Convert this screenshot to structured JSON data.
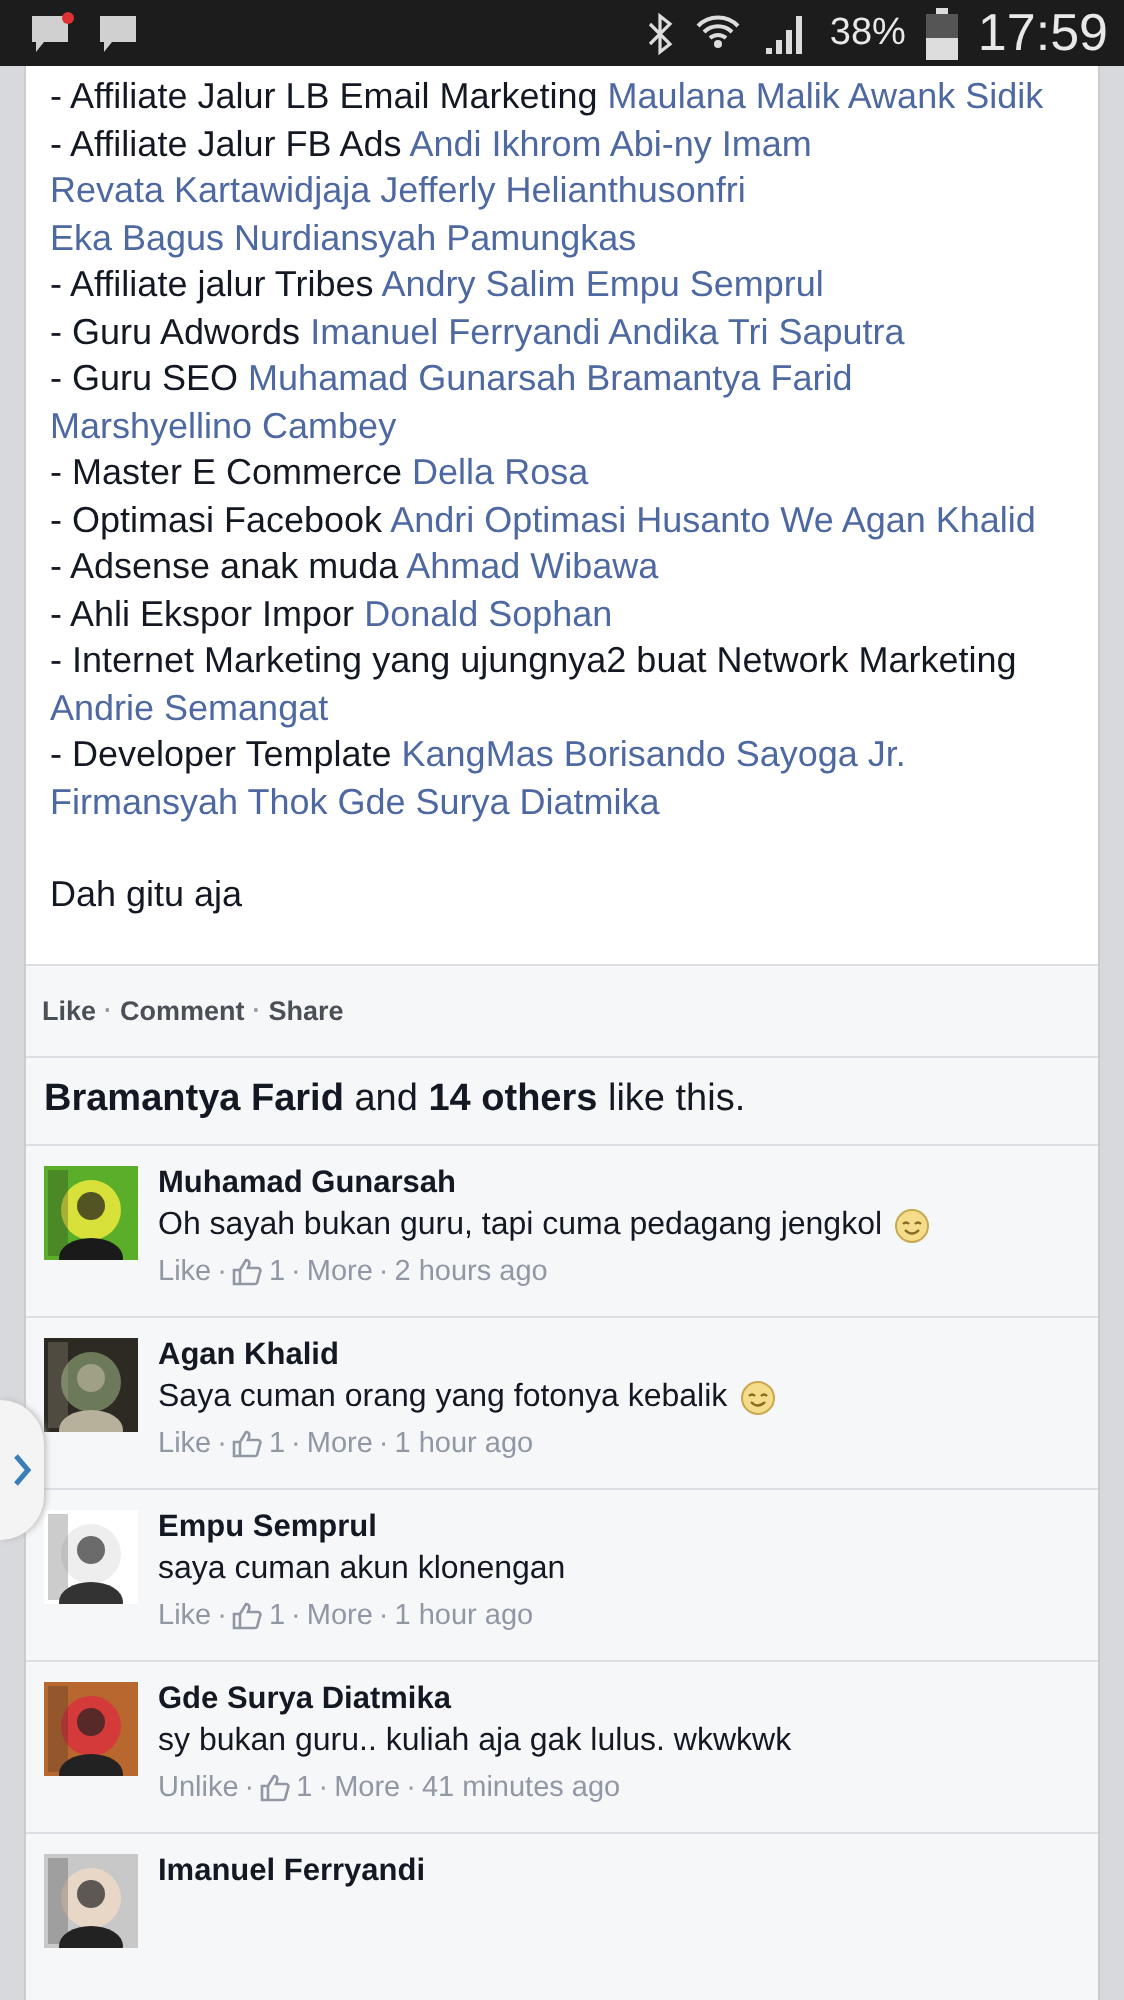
{
  "status_bar": {
    "battery": "38%",
    "time": "17:59"
  },
  "post": {
    "lines": [
      {
        "text": "- Affiliate Jalur LB Email Marketing",
        "tags": [
          "Maulana Malik",
          "Awank Sidik"
        ]
      },
      {
        "text": "- Affiliate Jalur FB Ads",
        "tags": [
          "Andi Ikhrom",
          "Abi-ny Imam",
          "Revata Kartawidjaja",
          "Jefferly Helianthusonfri",
          "Eka Bagus Nurdiansyah Pamungkas"
        ]
      },
      {
        "text": "- Affiliate jalur Tribes",
        "tags": [
          "Andry Salim",
          "Empu Semprul"
        ]
      },
      {
        "text": "- Guru Adwords",
        "tags": [
          "Imanuel Ferryandi",
          "Andika Tri Saputra"
        ]
      },
      {
        "text": "- Guru SEO",
        "tags": [
          "Muhamad Gunarsah",
          "Bramantya Farid",
          "Marshyellino Cambey"
        ]
      },
      {
        "text": "- Master E Commerce",
        "tags": [
          "Della Rosa"
        ]
      },
      {
        "text": "- Optimasi Facebook",
        "tags": [
          "Andri Optimasi Husanto We",
          "Agan Khalid"
        ]
      },
      {
        "text": "- Adsense anak muda",
        "tags": [
          "Ahmad Wibawa"
        ]
      },
      {
        "text": "- Ahli Ekspor Impor",
        "tags": [
          "Donald Sophan"
        ]
      },
      {
        "text": "- Internet Marketing yang ujungnya2 buat Network Marketing",
        "tags": [
          "Andrie Semangat"
        ]
      },
      {
        "text": "- Developer Template",
        "tags": [
          "KangMas Borisando Sayoga Jr.",
          "Firmansyah Thok",
          "Gde Surya Diatmika"
        ]
      }
    ],
    "closing": "Dah gitu aja"
  },
  "separator": "·",
  "actions": [
    "Like",
    "Comment",
    "Share"
  ],
  "likes_summary": "**Bramantya Farid** and **14 others** like this.",
  "comments": [
    {
      "name": "Muhamad Gunarsah",
      "text": "Oh sayah bukan guru, tapi cuma pedagang jengkol",
      "emoticon": true,
      "like_label": "Like",
      "like_count": "1",
      "more": "More",
      "time": "2 hours ago"
    },
    {
      "name": "Agan Khalid",
      "text": "Saya cuman orang yang fotonya kebalik",
      "emoticon": true,
      "like_label": "Like",
      "like_count": "1",
      "more": "More",
      "time": "1 hour ago"
    },
    {
      "name": "Empu Semprul",
      "text": "saya cuman akun klonengan",
      "emoticon": false,
      "like_label": "Like",
      "like_count": "1",
      "more": "More",
      "time": "1 hour ago"
    },
    {
      "name": "Gde Surya Diatmika",
      "text": "sy bukan guru.. kuliah aja gak lulus. wkwkwk",
      "emoticon": false,
      "like_label": "Unlike",
      "like_count": "1",
      "more": "More",
      "time": "41 minutes ago"
    },
    {
      "name": "Imanuel Ferryandi"
    }
  ]
}
